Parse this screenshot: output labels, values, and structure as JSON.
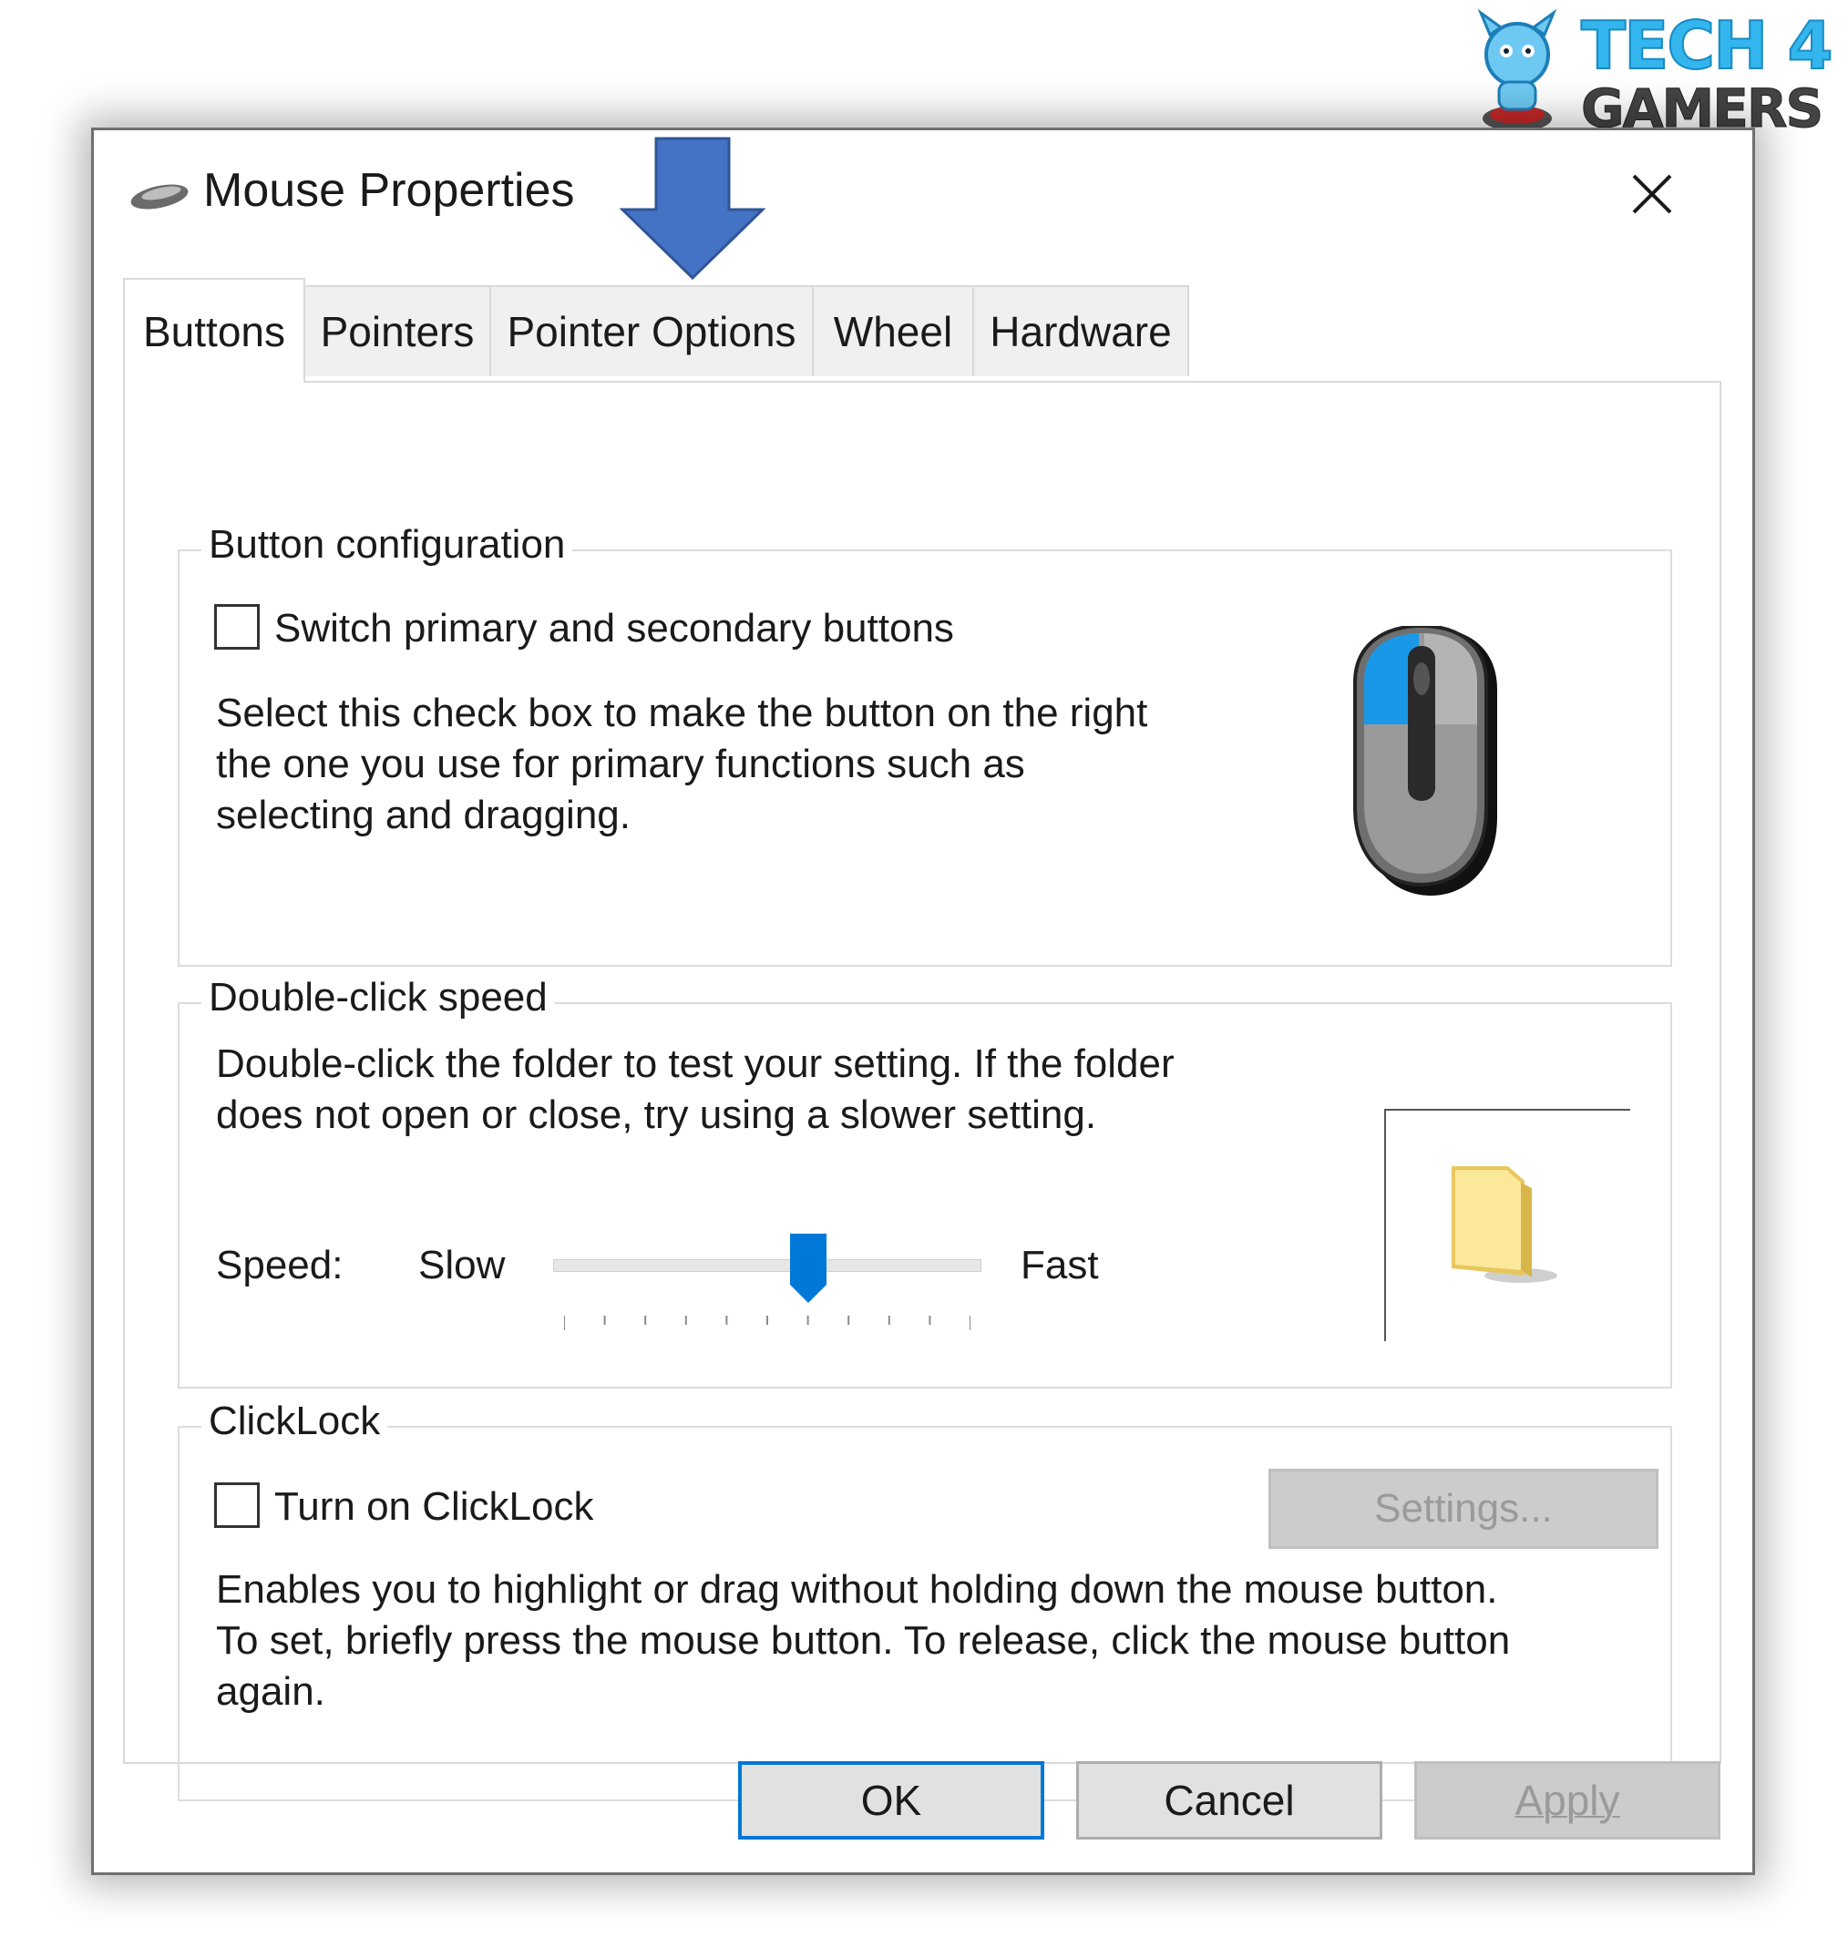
{
  "logo": {
    "line1": "TECH 4",
    "line2": "GAMERS"
  },
  "window": {
    "title": "Mouse Properties",
    "title_icon": "mouse-icon",
    "close_icon": "close-icon"
  },
  "annotation": {
    "icon": "arrow-down-icon",
    "color": "#4472c4"
  },
  "tabs": [
    {
      "label": "Buttons",
      "active": true
    },
    {
      "label": "Pointers"
    },
    {
      "label": "Pointer Options"
    },
    {
      "label": "Wheel"
    },
    {
      "label": "Hardware"
    }
  ],
  "button_configuration": {
    "legend": "Button configuration",
    "checkbox_label": "Switch primary and secondary buttons",
    "checked": false,
    "description": "Select this check box to make the button on the right\nthe one you use for primary functions such as\nselecting and dragging.",
    "image_icon": "mouse-illustration-icon"
  },
  "double_click": {
    "legend": "Double-click speed",
    "description": "Double-click the folder to test your setting. If the folder\ndoes not open or close, try using a slower setting.",
    "speed_label": "Speed:",
    "slow_label": "Slow",
    "fast_label": "Fast",
    "slider_value": 0.6,
    "tick_count": 11,
    "test_icon": "folder-icon"
  },
  "clicklock": {
    "legend": "ClickLock",
    "checkbox_label": "Turn on ClickLock",
    "checked": false,
    "settings_button": "Settings...",
    "description": "Enables you to highlight or drag without holding down the mouse button.\nTo set, briefly press the mouse button. To release, click the mouse button\nagain."
  },
  "footer": {
    "ok": "OK",
    "cancel": "Cancel",
    "apply": "Apply"
  },
  "colors": {
    "accent": "#0078d7",
    "mouse_highlight": "#1a98e8"
  }
}
